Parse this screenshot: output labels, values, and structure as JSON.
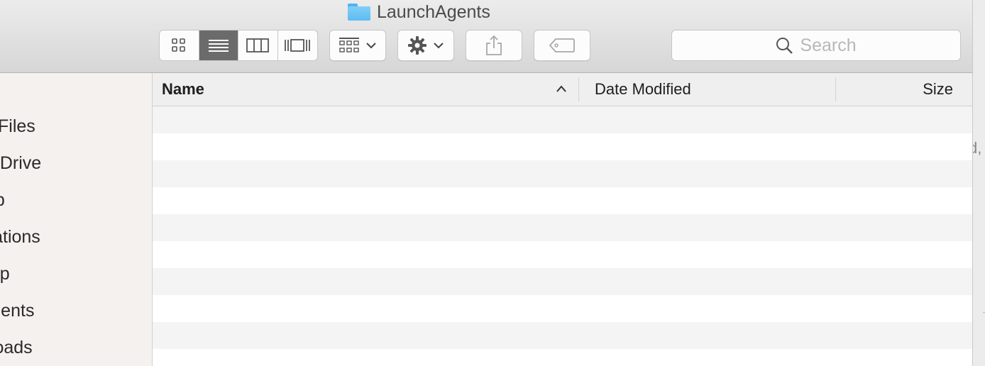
{
  "window": {
    "title": "LaunchAgents",
    "title_icon": "folder-icon"
  },
  "toolbar": {
    "view_modes": [
      {
        "name": "icon-view",
        "icon": "grid-icon",
        "selected": false
      },
      {
        "name": "list-view",
        "icon": "list-icon",
        "selected": true
      },
      {
        "name": "column-view",
        "icon": "columns-icon",
        "selected": false
      },
      {
        "name": "cover-flow-view",
        "icon": "cover-flow-icon",
        "selected": false
      }
    ],
    "arrange_icon": "arrange-icon",
    "action_icon": "gear-icon",
    "share_icon": "share-icon",
    "tag_icon": "tag-icon"
  },
  "search": {
    "placeholder": "Search",
    "icon": "search-icon"
  },
  "sidebar": {
    "items": [
      {
        "label": "All My Files"
      },
      {
        "label": "iCloud Drive"
      },
      {
        "label": "AirDrop"
      },
      {
        "label": "Applications"
      },
      {
        "label": "Desktop"
      },
      {
        "label": "Documents"
      },
      {
        "label": "Downloads"
      }
    ]
  },
  "columns": {
    "name": "Name",
    "date_modified": "Date Modified",
    "size": "Size",
    "sort_direction": "ascending"
  },
  "rows": [],
  "colors": {
    "selected_segment": "#6b6b6b",
    "folder": "#5dbcf2",
    "row_alt": "#f4f4f4"
  }
}
